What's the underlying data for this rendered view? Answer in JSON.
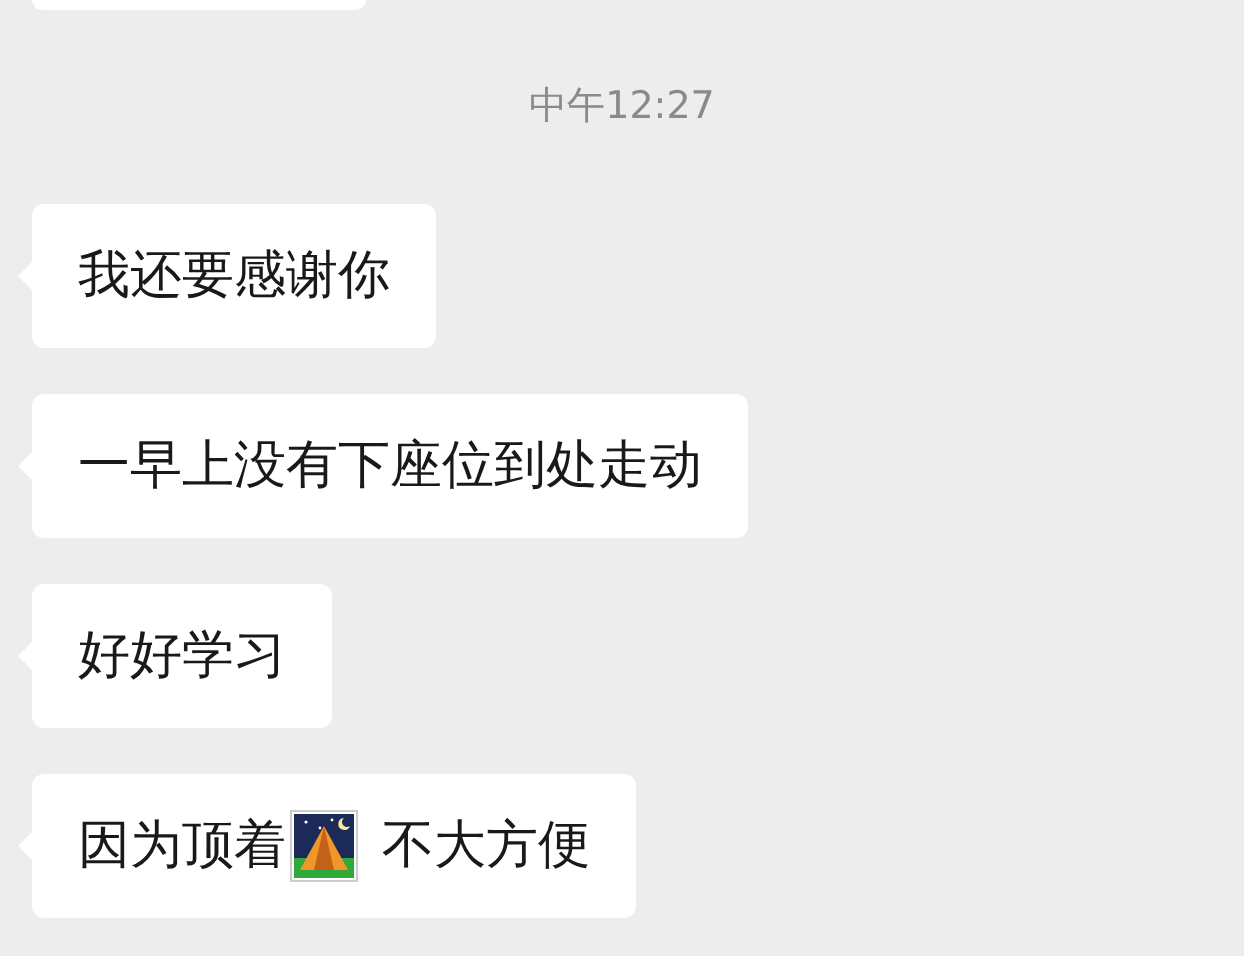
{
  "timestamp": "中午12:27",
  "messages": [
    {
      "kind": "text",
      "text": "我还要感谢你"
    },
    {
      "kind": "text",
      "text": "一早上没有下座位到处走动"
    },
    {
      "kind": "text",
      "text": "好好学习"
    },
    {
      "kind": "emoji",
      "before": "因为顶着",
      "after": "不大方便"
    }
  ]
}
